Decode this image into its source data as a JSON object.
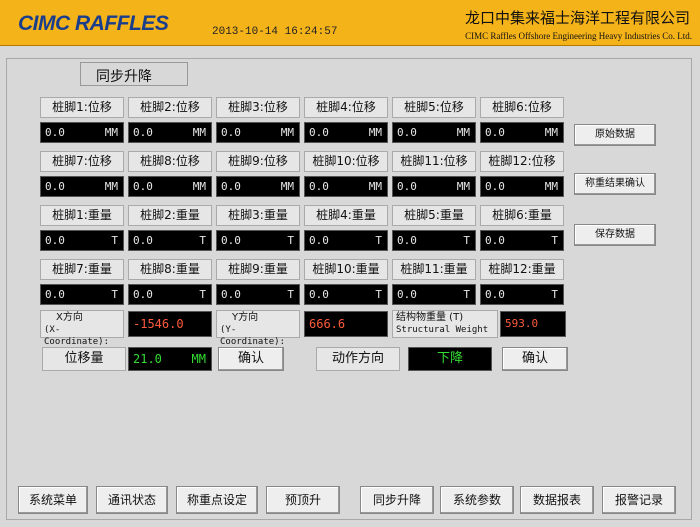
{
  "header": {
    "logo": "CIMC RAFFLES",
    "datetime": "2013-10-14  16:24:57",
    "company_cn": "龙口中集来福士海洋工程有限公司",
    "company_en": "CIMC Raffles Offshore Engineering Heavy Industries Co. Ltd.",
    "bg_color": "#f5b31a"
  },
  "panel": {
    "title": "同步升降"
  },
  "displacement": {
    "items": [
      {
        "label": "桩脚1:位移",
        "value": "0.0",
        "unit": "MM"
      },
      {
        "label": "桩脚2:位移",
        "value": "0.0",
        "unit": "MM"
      },
      {
        "label": "桩脚3:位移",
        "value": "0.0",
        "unit": "MM"
      },
      {
        "label": "桩脚4:位移",
        "value": "0.0",
        "unit": "MM"
      },
      {
        "label": "桩脚5:位移",
        "value": "0.0",
        "unit": "MM"
      },
      {
        "label": "桩脚6:位移",
        "value": "0.0",
        "unit": "MM"
      },
      {
        "label": "桩脚7:位移",
        "value": "0.0",
        "unit": "MM"
      },
      {
        "label": "桩脚8:位移",
        "value": "0.0",
        "unit": "MM"
      },
      {
        "label": "桩脚9:位移",
        "value": "0.0",
        "unit": "MM"
      },
      {
        "label": "桩脚10:位移",
        "value": "0.0",
        "unit": "MM"
      },
      {
        "label": "桩脚11:位移",
        "value": "0.0",
        "unit": "MM"
      },
      {
        "label": "桩脚12:位移",
        "value": "0.0",
        "unit": "MM"
      }
    ]
  },
  "weight": {
    "items": [
      {
        "label": "桩脚1:重量",
        "value": "0.0",
        "unit": "T"
      },
      {
        "label": "桩脚2:重量",
        "value": "0.0",
        "unit": "T"
      },
      {
        "label": "桩脚3:重量",
        "value": "0.0",
        "unit": "T"
      },
      {
        "label": "桩脚4:重量",
        "value": "0.0",
        "unit": "T"
      },
      {
        "label": "桩脚5:重量",
        "value": "0.0",
        "unit": "T"
      },
      {
        "label": "桩脚6:重量",
        "value": "0.0",
        "unit": "T"
      },
      {
        "label": "桩脚7:重量",
        "value": "0.0",
        "unit": "T"
      },
      {
        "label": "桩脚8:重量",
        "value": "0.0",
        "unit": "T"
      },
      {
        "label": "桩脚9:重量",
        "value": "0.0",
        "unit": "T"
      },
      {
        "label": "桩脚10:重量",
        "value": "0.0",
        "unit": "T"
      },
      {
        "label": "桩脚11:重量",
        "value": "0.0",
        "unit": "T"
      },
      {
        "label": "桩脚12:重量",
        "value": "0.0",
        "unit": "T"
      }
    ]
  },
  "right_buttons": {
    "raw_data": "原始数据",
    "weigh_confirm": "称重结果确认",
    "save_data": "保存数据"
  },
  "coordinates": {
    "x_label_cn": "X方向",
    "x_label_en": "(X-Coordinate):",
    "x_value": "-1546.0",
    "y_label_cn": "Y方向",
    "y_label_en": "(Y-Coordinate):",
    "y_value": "666.6",
    "weight_label_cn": "结构物重量 (T)",
    "weight_label_en": "Structural Weight",
    "weight_value": "593.0"
  },
  "controls": {
    "displacement_label": "位移量",
    "displacement_value": "21.0",
    "displacement_unit": "MM",
    "confirm1": "确认",
    "direction_label": "动作方向",
    "direction_value": "下降",
    "confirm2": "确认"
  },
  "nav": [
    "系统菜单",
    "通讯状态",
    "称重点设定",
    "预顶升",
    "同步升降",
    "系统参数",
    "数据报表",
    "报警记录"
  ]
}
